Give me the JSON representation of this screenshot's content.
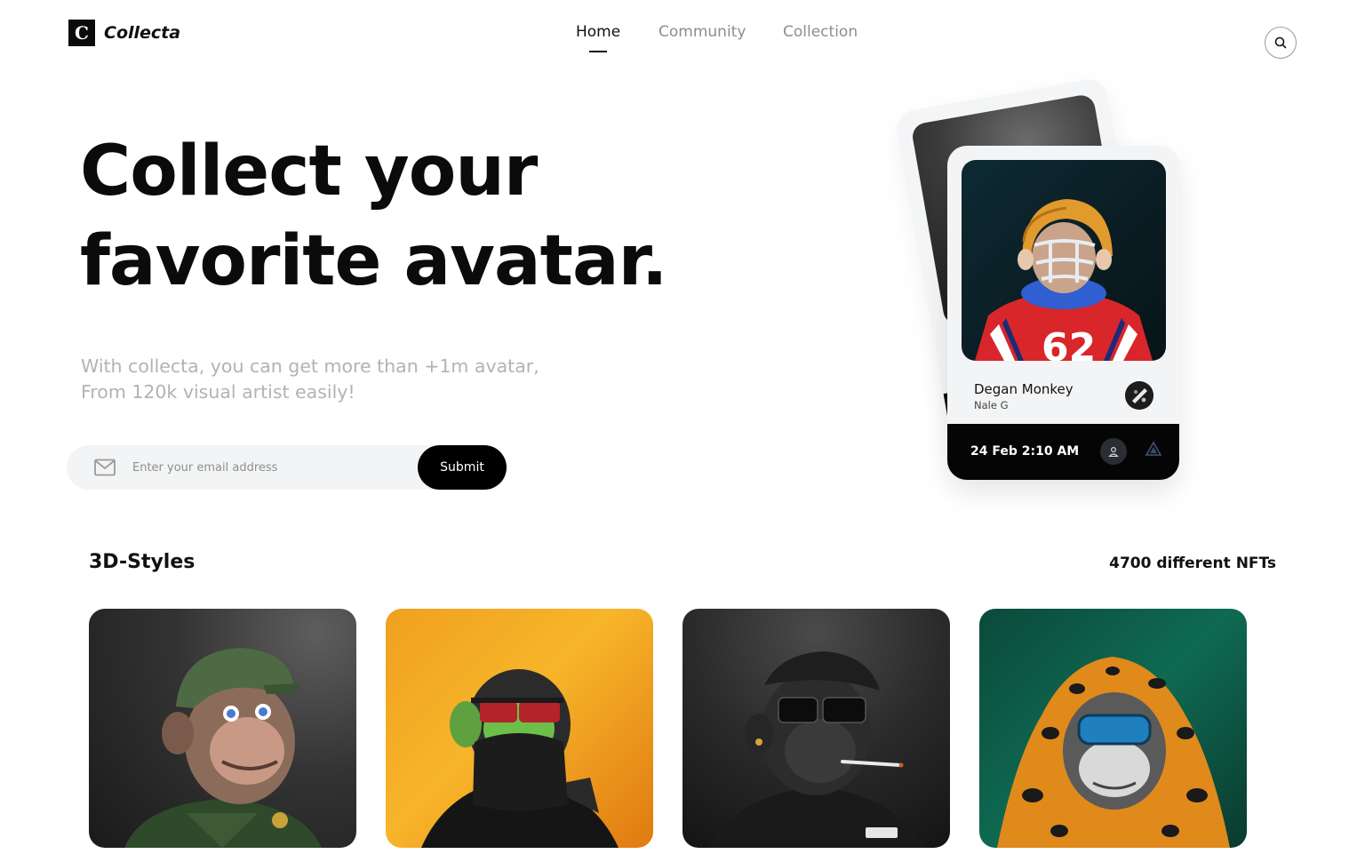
{
  "brand": {
    "logo_letter": "C",
    "name": "Collecta"
  },
  "nav": {
    "items": [
      "Home",
      "Community",
      "Collection"
    ],
    "active": "Home"
  },
  "header": {
    "search_icon": "search-icon"
  },
  "hero": {
    "title_line1": "Collect your",
    "title_line2": "favorite avatar.",
    "subtitle_line1": "With collecta, you can get more than +1m avatar,",
    "subtitle_line2": "From 120k visual artist easily!",
    "email_placeholder": "Enter your email address",
    "submit_label": "Submit"
  },
  "featured_card": {
    "name": "Degan Monkey",
    "artist": "Nale G",
    "date": "24 Feb 2:10 AM",
    "icons": [
      "user-icon",
      "ethereum-icon"
    ]
  },
  "section": {
    "title": "3D-Styles",
    "count": "4700 different NFTs"
  },
  "tiles": [
    {
      "theme": "helmet-monkey",
      "bg": "#2b2b2b"
    },
    {
      "theme": "red-glasses-monkey",
      "bg": "#f2a426"
    },
    {
      "theme": "smoking-monkey",
      "bg": "#222222"
    },
    {
      "theme": "leopard-hood-monkey",
      "bg": "#0e5d49"
    }
  ],
  "colors": {
    "primary": "#000000",
    "muted_text": "#b3b3b3",
    "card_bg": "#f3f4f5"
  }
}
